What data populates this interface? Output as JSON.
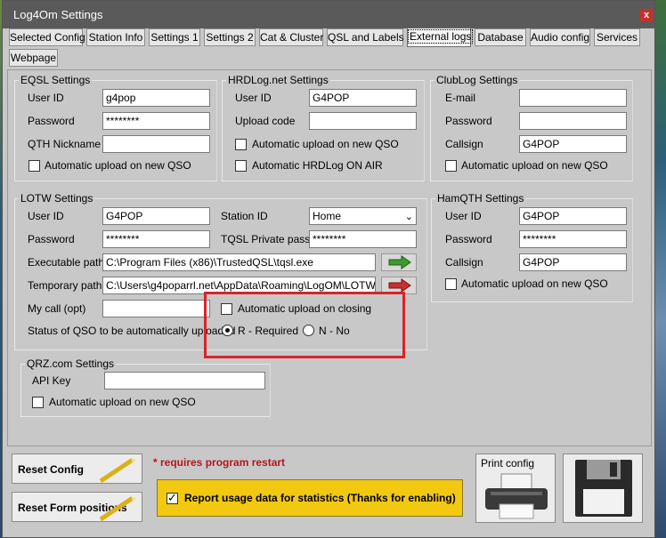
{
  "window": {
    "title": "Log4Om Settings",
    "close_label": "x"
  },
  "tabs": [
    "Selected Config",
    "Station Info",
    "Settings 1",
    "Settings 2",
    "Cat & Cluster",
    "QSL and Labels",
    "External logs",
    "Database",
    "Audio config",
    "Services",
    "Webpage"
  ],
  "eqsl": {
    "title": "EQSL Settings",
    "user_id_label": "User ID",
    "user_id": "g4pop",
    "password_label": "Password",
    "password": "********",
    "qth_label": "QTH Nickname",
    "qth": "",
    "auto_label": "Automatic upload on new QSO",
    "auto": false
  },
  "hrdlog": {
    "title": "HRDLog.net Settings",
    "user_id_label": "User ID",
    "user_id": "G4POP",
    "upload_code_label": "Upload code",
    "upload_code": "",
    "auto_label": "Automatic upload on new QSO",
    "auto": false,
    "onair_label": "Automatic HRDLog ON AIR",
    "onair": false
  },
  "clublog": {
    "title": "ClubLog Settings",
    "email_label": "E-mail",
    "email": "",
    "password_label": "Password",
    "password": "",
    "callsign_label": "Callsign",
    "callsign": "G4POP",
    "auto_label": "Automatic upload on new QSO",
    "auto": false
  },
  "lotw": {
    "title": "LOTW Settings",
    "user_id_label": "User ID",
    "user_id": "G4POP",
    "password_label": "Password",
    "password": "********",
    "station_id_label": "Station ID",
    "station_id": "Home",
    "tqsl_pass_label": "TQSL Private pass",
    "tqsl_pass": "********",
    "exe_path_label": "Executable path",
    "exe_path": "C:\\Program Files (x86)\\TrustedQSL\\tqsl.exe",
    "temp_path_label": "Temporary path",
    "temp_path": "C:\\Users\\g4poparrl.net\\AppData\\Roaming\\LogOM\\LOTW",
    "my_call_label": "My call (opt)",
    "my_call": "",
    "auto_close_label": "Automatic upload on closing",
    "auto_close": false,
    "status_label": "Status of QSO to be automatically uploaded",
    "radio_required_label": "R - Required",
    "radio_no_label": "N - No",
    "selected_status": "R - Required"
  },
  "hamqth": {
    "title": "HamQTH Settings",
    "user_id_label": "User ID",
    "user_id": "G4POP",
    "password_label": "Password",
    "password": "********",
    "callsign_label": "Callsign",
    "callsign": "G4POP",
    "auto_label": "Automatic upload on new QSO",
    "auto": false
  },
  "qrz": {
    "title": "QRZ.com Settings",
    "api_label": "API Key",
    "api_key": "",
    "auto_label": "Automatic upload on new QSO",
    "auto": false
  },
  "footer": {
    "reset_config": "Reset Config",
    "reset_positions": "Reset Form positions",
    "restart_note": "* requires program restart",
    "usage_label": "Report usage data for statistics (Thanks for enabling)",
    "usage_checked": true,
    "print_label": "Print config"
  },
  "colors": {
    "highlight": "#d8242a",
    "usage_bg": "#f2c811",
    "restart_text": "#b3161c"
  }
}
